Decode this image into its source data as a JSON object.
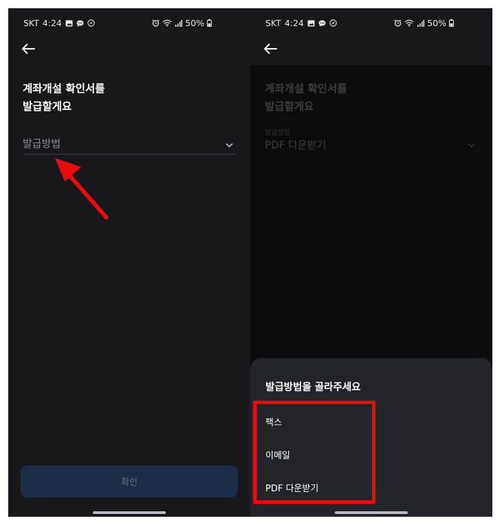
{
  "status_bar": {
    "carrier": "SKT",
    "time": "4:24",
    "battery": "50%"
  },
  "left_screen": {
    "heading_line1": "계좌개설 확인서를",
    "heading_line2": "발급할게요",
    "select_placeholder": "발급방법",
    "confirm_label": "확인"
  },
  "right_screen": {
    "heading_line1": "계좌개설 확인서를",
    "heading_line2": "발급할게요",
    "select_label": "발급방법",
    "select_value": "PDF 다운받기",
    "sheet": {
      "title": "발급방법을 골라주세요",
      "options": [
        "팩스",
        "이메일",
        "PDF 다운받기"
      ]
    }
  },
  "colors": {
    "screen_bg": "#17171c",
    "sheet_bg": "#23232a",
    "confirm_bg": "#1c2c47",
    "annotation_red": "#ea0c0c"
  },
  "icons": {
    "back": "arrow-left-icon",
    "chevron": "chevron-down-icon",
    "gallery": "image-icon",
    "chat": "chat-bubble-icon",
    "sync": "compass-icon",
    "alarm": "alarm-icon",
    "wifi": "wifi-icon",
    "signal": "signal-icon",
    "battery": "battery-icon"
  }
}
